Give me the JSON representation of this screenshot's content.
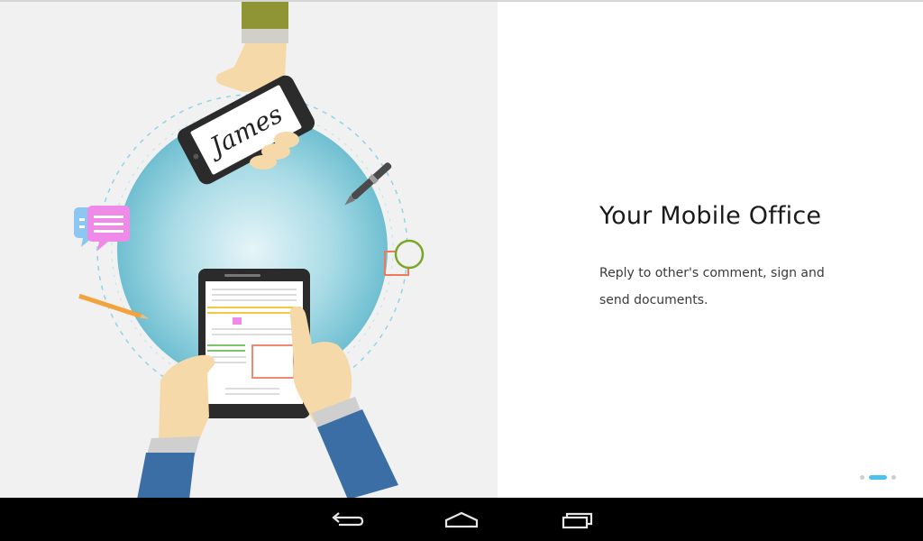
{
  "onboarding": {
    "title": "Your Mobile Office",
    "description": "Reply to other's comment, sign and send documents.",
    "signature_text": "James",
    "page_count": 3,
    "current_page": 2,
    "colors": {
      "accent": "#4fc1ee",
      "globe": "#8fcddb",
      "sleeve": "#3a6ea5",
      "illustration_background": "#f1f1f1"
    }
  },
  "system_nav": {
    "buttons": [
      {
        "name": "back",
        "icon": "back-arrow-icon"
      },
      {
        "name": "home",
        "icon": "home-icon"
      },
      {
        "name": "recents",
        "icon": "recent-apps-icon"
      }
    ]
  }
}
